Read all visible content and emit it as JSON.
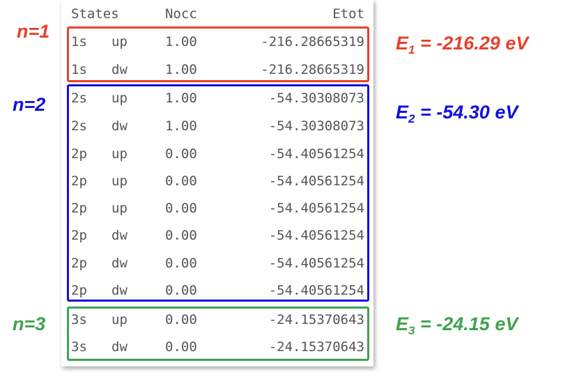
{
  "header": {
    "states": "States",
    "nocc": "Nocc",
    "etot": "Etot"
  },
  "rows": [
    {
      "state": "1s",
      "spin": "up",
      "nocc": "1.00",
      "etot": "-216.28665319"
    },
    {
      "state": "1s",
      "spin": "dw",
      "nocc": "1.00",
      "etot": "-216.28665319"
    },
    {
      "state": "2s",
      "spin": "up",
      "nocc": "1.00",
      "etot": "-54.30308073"
    },
    {
      "state": "2s",
      "spin": "dw",
      "nocc": "1.00",
      "etot": "-54.30308073"
    },
    {
      "state": "2p",
      "spin": "up",
      "nocc": "0.00",
      "etot": "-54.40561254"
    },
    {
      "state": "2p",
      "spin": "up",
      "nocc": "0.00",
      "etot": "-54.40561254"
    },
    {
      "state": "2p",
      "spin": "up",
      "nocc": "0.00",
      "etot": "-54.40561254"
    },
    {
      "state": "2p",
      "spin": "dw",
      "nocc": "0.00",
      "etot": "-54.40561254"
    },
    {
      "state": "2p",
      "spin": "dw",
      "nocc": "0.00",
      "etot": "-54.40561254"
    },
    {
      "state": "2p",
      "spin": "dw",
      "nocc": "0.00",
      "etot": "-54.40561254"
    },
    {
      "state": "3s",
      "spin": "up",
      "nocc": "0.00",
      "etot": "-24.15370643"
    },
    {
      "state": "3s",
      "spin": "dw",
      "nocc": "0.00",
      "etot": "-24.15370643"
    }
  ],
  "groups": [
    {
      "n_label": "n=1",
      "e_prefix": "E",
      "e_sub": "1",
      "e_value": " = -216.29 eV",
      "color": "#e8402a"
    },
    {
      "n_label": "n=2",
      "e_prefix": "E",
      "e_sub": "2",
      "e_value": " = -54.30 eV",
      "color": "#1010dd"
    },
    {
      "n_label": "n=3",
      "e_prefix": "E",
      "e_sub": "3",
      "e_value": " = -24.15 eV",
      "color": "#3fa34d"
    }
  ]
}
